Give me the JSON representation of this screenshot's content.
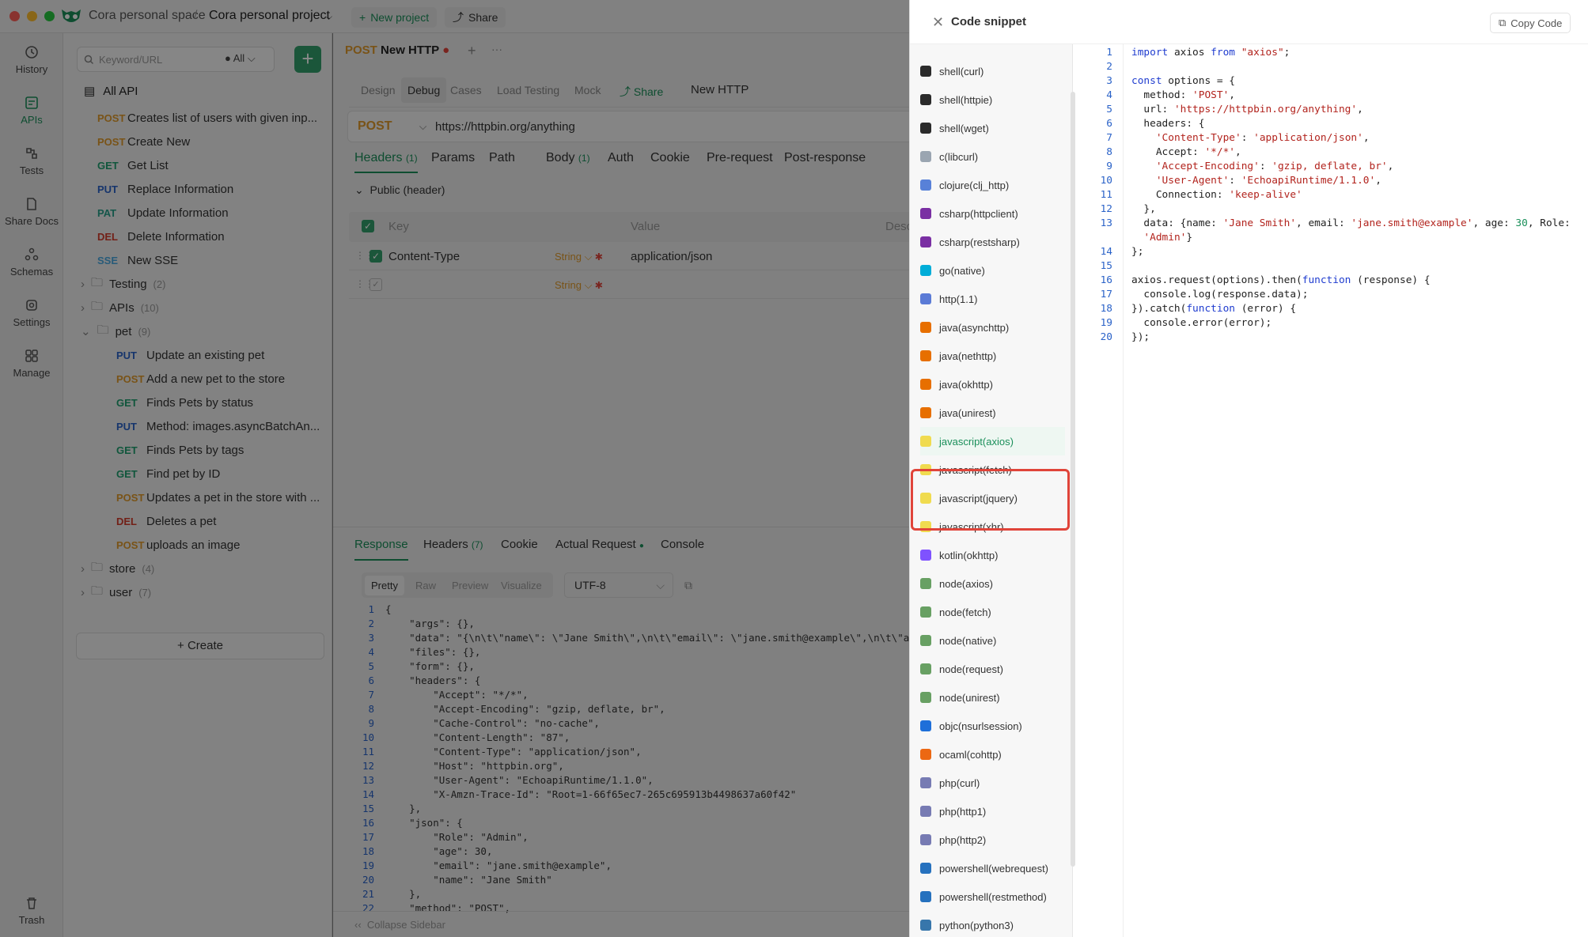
{
  "window": {
    "workspace": "Cora personal space",
    "project": "Cora personal project",
    "new_project": "New project",
    "share": "Share"
  },
  "rail": [
    "History",
    "APIs",
    "Tests",
    "Share Docs",
    "Schemas",
    "Settings",
    "Manage",
    "Trash"
  ],
  "tree": {
    "search_placeholder": "Keyword/URL",
    "filter": "All",
    "all_api": "All API",
    "create": "Create",
    "root_items": [
      {
        "method": "POST",
        "label": "Creates list of users with given inp..."
      },
      {
        "method": "POST",
        "label": "Create New"
      },
      {
        "method": "GET",
        "label": "Get List"
      },
      {
        "method": "PUT",
        "label": "Replace Information"
      },
      {
        "method": "PAT",
        "label": "Update Information"
      },
      {
        "method": "DEL",
        "label": "Delete Information"
      },
      {
        "method": "SSE",
        "label": "New SSE"
      }
    ],
    "folders": [
      {
        "name": "Testing",
        "count": "(2)"
      },
      {
        "name": "APIs",
        "count": "(10)"
      },
      {
        "name": "pet",
        "count": "(9)"
      },
      {
        "name": "store",
        "count": "(4)"
      },
      {
        "name": "user",
        "count": "(7)"
      }
    ],
    "pet_items": [
      {
        "method": "PUT",
        "label": "Update an existing pet"
      },
      {
        "method": "POST",
        "label": "Add a new pet to the store"
      },
      {
        "method": "GET",
        "label": "Finds Pets by status"
      },
      {
        "method": "PUT",
        "label": "Method: images.asyncBatchAn..."
      },
      {
        "method": "GET",
        "label": "Finds Pets by tags"
      },
      {
        "method": "GET",
        "label": "Find pet by ID"
      },
      {
        "method": "POST",
        "label": "Updates a pet in the store with ..."
      },
      {
        "method": "DEL",
        "label": "Deletes a pet"
      },
      {
        "method": "POST",
        "label": "uploads an image"
      }
    ]
  },
  "main": {
    "tab_method": "POST",
    "tab_title": "New HTTP",
    "modes": [
      "Design",
      "Debug",
      "Cases",
      "Load Testing",
      "Mock"
    ],
    "share": "Share",
    "request_name": "New HTTP",
    "method": "POST",
    "url": "https://httpbin.org/anything",
    "req_tabs": [
      "Headers",
      "Params",
      "Path",
      "Body",
      "Auth",
      "Cookie",
      "Pre-request",
      "Post-response"
    ],
    "headers_count": "(1)",
    "body_count": "(1)",
    "public_header": "Public  (header)",
    "col_key": "Key",
    "col_value": "Value",
    "col_desc": "Desc",
    "header_key": "Content-Type",
    "header_type": "String",
    "header_value": "application/json",
    "empty_type": "String",
    "resp_tabs": [
      "Response",
      "Headers",
      "Cookie",
      "Actual Request",
      "Console"
    ],
    "resp_headers_count": "(7)",
    "view_modes": [
      "Pretty",
      "Raw",
      "Preview",
      "Visualize"
    ],
    "encoding": "UTF-8",
    "collapse": "Collapse Sidebar",
    "response_lines": [
      "{",
      "    \"args\": {},",
      "    \"data\": \"{\\n\\t\\\"name\\\": \\\"Jane Smith\\\",\\n\\t\\\"email\\\": \\\"jane.smith@example\\\",\\n\\t\\\"ag",
      "    \"files\": {},",
      "    \"form\": {},",
      "    \"headers\": {",
      "        \"Accept\": \"*/*\",",
      "        \"Accept-Encoding\": \"gzip, deflate, br\",",
      "        \"Cache-Control\": \"no-cache\",",
      "        \"Content-Length\": \"87\",",
      "        \"Content-Type\": \"application/json\",",
      "        \"Host\": \"httpbin.org\",",
      "        \"User-Agent\": \"EchoapiRuntime/1.1.0\",",
      "        \"X-Amzn-Trace-Id\": \"Root=1-66f65ec7-265c695913b4498637a60f42\"",
      "    },",
      "    \"json\": {",
      "        \"Role\": \"Admin\",",
      "        \"age\": 30,",
      "        \"email\": \"jane.smith@example\",",
      "        \"name\": \"Jane Smith\"",
      "    },",
      "    \"method\": \"POST\","
    ]
  },
  "panel": {
    "title": "Code snippet",
    "copy": "Copy Code",
    "selected": "javascript(axios)",
    "languages": [
      "shell(curl)",
      "shell(httpie)",
      "shell(wget)",
      "c(libcurl)",
      "clojure(clj_http)",
      "csharp(httpclient)",
      "csharp(restsharp)",
      "go(native)",
      "http(1.1)",
      "java(asynchttp)",
      "java(nethttp)",
      "java(okhttp)",
      "java(unirest)",
      "javascript(axios)",
      "javascript(fetch)",
      "javascript(jquery)",
      "javascript(xhr)",
      "kotlin(okhttp)",
      "node(axios)",
      "node(fetch)",
      "node(native)",
      "node(request)",
      "node(unirest)",
      "objc(nsurlsession)",
      "ocaml(cohttp)",
      "php(curl)",
      "php(http1)",
      "php(http2)",
      "powershell(webrequest)",
      "powershell(restmethod)",
      "python(python3)"
    ],
    "icon_colors": [
      "#2b2b2b",
      "#2b2b2b",
      "#2b2b2b",
      "#9aa5b1",
      "#5881d8",
      "#7a2fa3",
      "#7a2fa3",
      "#00add8",
      "#5b7bd6",
      "#e76f00",
      "#e76f00",
      "#e76f00",
      "#e76f00",
      "#f0db4f",
      "#f0db4f",
      "#f0db4f",
      "#f0db4f",
      "#7f52ff",
      "#68a063",
      "#68a063",
      "#68a063",
      "#68a063",
      "#68a063",
      "#1e6fd9",
      "#ec6813",
      "#777bb3",
      "#777bb3",
      "#777bb3",
      "#2671be",
      "#2671be",
      "#3776ab"
    ],
    "code_lines": [
      [
        "1",
        "import axios from \"axios\";"
      ],
      [
        "2",
        ""
      ],
      [
        "3",
        "const options = {"
      ],
      [
        "4",
        "  method: 'POST',"
      ],
      [
        "5",
        "  url: 'https://httpbin.org/anything',"
      ],
      [
        "6",
        "  headers: {"
      ],
      [
        "7",
        "    'Content-Type': 'application/json',"
      ],
      [
        "8",
        "    Accept: '*/*',"
      ],
      [
        "9",
        "    'Accept-Encoding': 'gzip, deflate, br',"
      ],
      [
        "10",
        "    'User-Agent': 'EchoapiRuntime/1.1.0',"
      ],
      [
        "11",
        "    Connection: 'keep-alive'"
      ],
      [
        "12",
        "  },"
      ],
      [
        "13",
        "  data: {name: 'Jane Smith', email: 'jane.smith@example', age: 30, Role:"
      ],
      [
        "",
        "  'Admin'}"
      ],
      [
        "14",
        "};"
      ],
      [
        "15",
        ""
      ],
      [
        "16",
        "axios.request(options).then(function (response) {"
      ],
      [
        "17",
        "  console.log(response.data);"
      ],
      [
        "18",
        "}).catch(function (error) {"
      ],
      [
        "19",
        "  console.error(error);"
      ],
      [
        "20",
        "});"
      ]
    ]
  }
}
